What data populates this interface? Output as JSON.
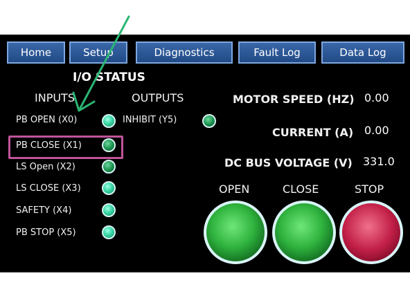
{
  "tabs": [
    {
      "label": "Home"
    },
    {
      "label": "Setup"
    },
    {
      "label": "Diagnostics"
    },
    {
      "label": "Fault Log"
    },
    {
      "label": "Data Log"
    }
  ],
  "io_status": {
    "title": "I/O STATUS",
    "inputs_header": "INPUTS",
    "outputs_header": "OUTPUTS",
    "inputs": [
      {
        "label": "PB OPEN (X0)",
        "state": "on"
      },
      {
        "label": "PB CLOSE (X1)",
        "state": "off"
      },
      {
        "label": "LS Open (X2)",
        "state": "off"
      },
      {
        "label": "LS CLOSE (X3)",
        "state": "on"
      },
      {
        "label": "SAFETY (X4)",
        "state": "on"
      },
      {
        "label": "PB STOP (X5)",
        "state": "on"
      }
    ],
    "outputs": [
      {
        "label": "INHIBIT (Y5)",
        "state": "off"
      }
    ]
  },
  "readouts": {
    "motor_speed_label": "MOTOR SPEED (HZ)",
    "motor_speed_value": "0.00",
    "current_label": "CURRENT (A)",
    "current_value": "0.00",
    "dc_bus_label": "DC BUS VOLTAGE (V)",
    "dc_bus_value": "331.0"
  },
  "controls": {
    "open_label": "OPEN",
    "close_label": "CLOSE",
    "stop_label": "STOP"
  },
  "annotation": {
    "arrow_color": "#2bb673",
    "highlight_color": "#c0559a"
  }
}
